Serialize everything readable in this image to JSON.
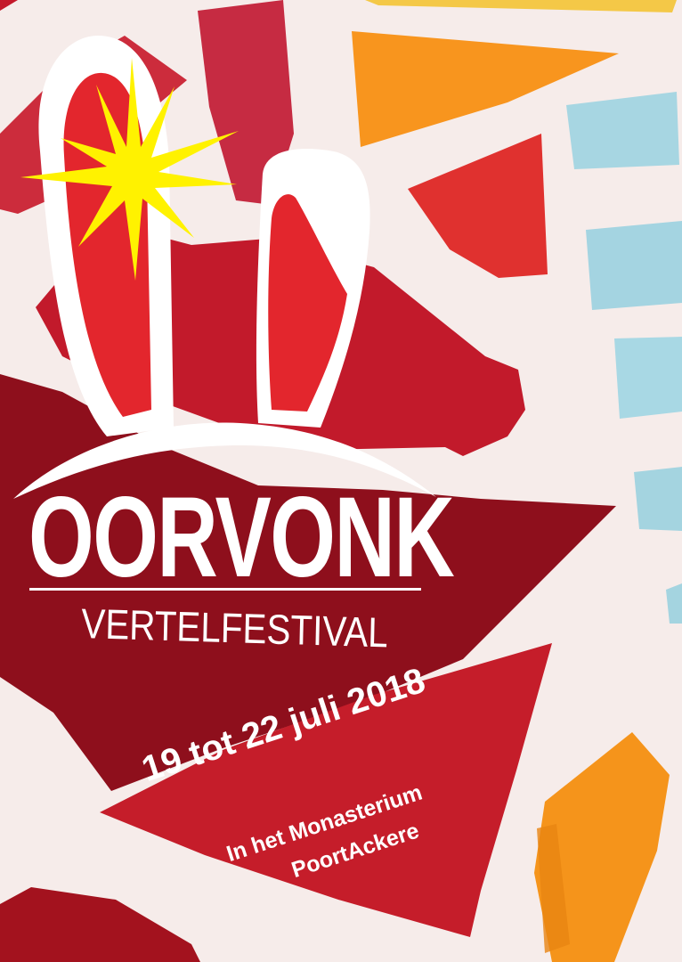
{
  "logo": {
    "name": "OORVONK",
    "subtitle": "VERTELFESTIVAL"
  },
  "event": {
    "dates": "19 tot 22 juli 2018",
    "venue_line1": "In het Monasterium",
    "venue_line2": "PoortAckere"
  },
  "colors": {
    "background": "#f6ecea",
    "deep_red": "#8c0f1a",
    "red": "#d3202c",
    "orange": "#f7941d",
    "light_blue": "#a9dbe8",
    "star_yellow": "#fff200",
    "text": "#ffffff"
  },
  "icons": [
    "rabbit-ears-icon",
    "spark-star-icon"
  ]
}
